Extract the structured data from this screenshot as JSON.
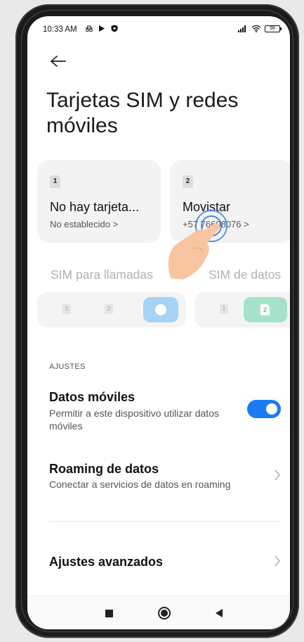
{
  "status_bar": {
    "time": "10:33 AM",
    "icons_left": [
      "incognito-icon",
      "play-arrow-icon",
      "shield-icon"
    ],
    "icons_right": [
      "signal-icon",
      "wifi-icon",
      "battery-icon"
    ],
    "battery": "98"
  },
  "header": {
    "title": "Tarjetas SIM y redes móviles"
  },
  "sim_cards": [
    {
      "slot": "1",
      "name": "No hay tarjeta...",
      "detail": "No establecido >"
    },
    {
      "slot": "2",
      "name": "Movistar",
      "detail": "+57 76608076 >"
    }
  ],
  "preferences": {
    "calls_label": "SIM para llamadas",
    "data_label": "SIM de datos",
    "calls_options": [
      "1",
      "2"
    ],
    "data_options": [
      "1",
      "2"
    ]
  },
  "settings": {
    "section_header": "AJUSTES",
    "mobile_data": {
      "title": "Datos móviles",
      "subtitle": "Permitir a este dispositivo utilizar datos móviles",
      "enabled": true
    },
    "roaming": {
      "title": "Roaming de datos",
      "subtitle": "Conectar a servicios de datos en roaming"
    },
    "advanced": {
      "title": "Ajustes avanzados"
    }
  },
  "colors": {
    "accent_blue": "#1a7cf0",
    "selected_calls": "#a7d3f6",
    "selected_data": "#a5e3c9",
    "hand": "#f7c59f"
  }
}
